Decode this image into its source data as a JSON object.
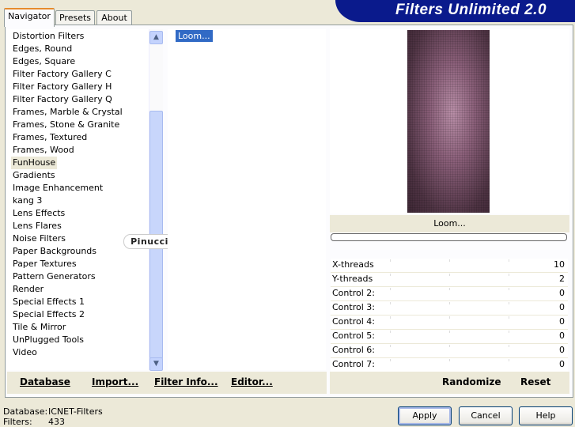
{
  "app": {
    "title": "Filters Unlimited 2.0"
  },
  "tabs": [
    {
      "label": "Navigator"
    },
    {
      "label": "Presets"
    },
    {
      "label": "About"
    }
  ],
  "categories": {
    "items": [
      "Distortion Filters",
      "Edges, Round",
      "Edges, Square",
      "Filter Factory Gallery C",
      "Filter Factory Gallery H",
      "Filter Factory Gallery Q",
      "Frames, Marble & Crystal",
      "Frames, Stone & Granite",
      "Frames, Textured",
      "Frames, Wood",
      "FunHouse",
      "Gradients",
      "Image Enhancement",
      "kang 3",
      "Lens Effects",
      "Lens Flares",
      "Noise Filters",
      "Paper Backgrounds",
      "Paper Textures",
      "Pattern Generators",
      "Render",
      "Special Effects 1",
      "Special Effects 2",
      "Tile & Mirror",
      "UnPlugged Tools",
      "Video"
    ],
    "selected": "FunHouse"
  },
  "filters": {
    "items": [
      "Loom..."
    ],
    "selected": "Loom..."
  },
  "left_buttons": {
    "database": "Database",
    "import": "Import...",
    "filter_info": "Filter Info...",
    "editor": "Editor..."
  },
  "preview": {
    "label": "Loom..."
  },
  "controls": [
    {
      "label": "X-threads",
      "value": "10"
    },
    {
      "label": "Y-threads",
      "value": "2"
    },
    {
      "label": "Control 2:",
      "value": "0"
    },
    {
      "label": "Control 3:",
      "value": "0"
    },
    {
      "label": "Control 4:",
      "value": "0"
    },
    {
      "label": "Control 5:",
      "value": "0"
    },
    {
      "label": "Control 6:",
      "value": "0"
    },
    {
      "label": "Control 7:",
      "value": "0"
    }
  ],
  "right_buttons": {
    "randomize": "Randomize",
    "reset": "Reset"
  },
  "status": {
    "database_label": "Database:",
    "database_value": "ICNET-Filters",
    "filters_label": "Filters:",
    "filters_value": "433"
  },
  "dialog_buttons": {
    "apply": "Apply",
    "cancel": "Cancel",
    "help": "Help"
  },
  "watermark": "Pinuccia",
  "colors": {
    "banner": "#0a1a8c",
    "selection": "#316ac5",
    "window": "#ece9d8"
  }
}
